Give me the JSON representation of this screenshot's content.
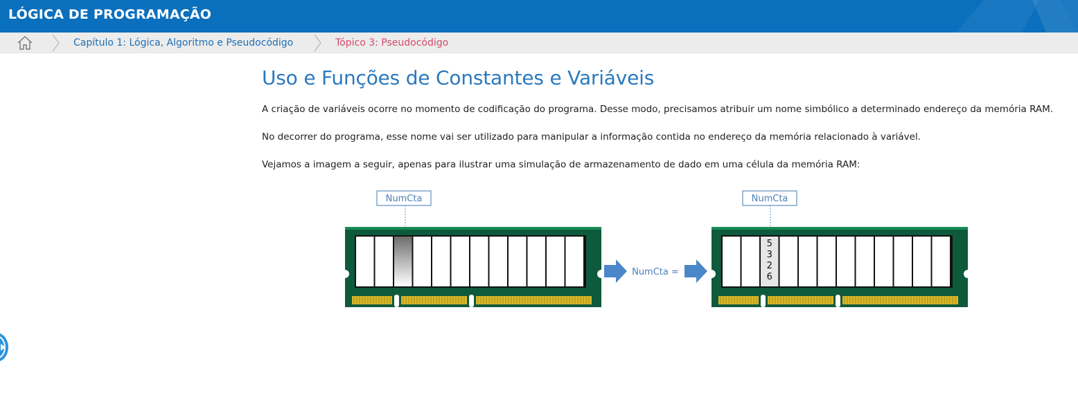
{
  "header": {
    "title": "LÓGICA DE PROGRAMAÇÃO",
    "bar_color": "#0a6fbd"
  },
  "breadcrumb": {
    "home_icon": "home-icon",
    "items": [
      {
        "label": "Capítulo 1: Lógica, Algoritmo e Pseudocódigo",
        "color": "#1e6fb5"
      },
      {
        "label": "Tópico 3: Pseudocódigo",
        "color": "#d34a6e"
      }
    ]
  },
  "main": {
    "title": "Uso e Funções de Constantes e Variáveis",
    "paragraphs": [
      "A criação de variáveis ocorre no momento de codificação do programa. Desse modo, precisamos atribuir um nome simbólico a determinado endereço da memória RAM.",
      "No decorrer do programa, esse nome vai ser utilizado para manipular a informação contida no endereço da memória relacionado à variável.",
      "Vejamos a imagem a seguir, apenas para ilustrar uma simulação de armazenamento de dado em uma célula da memória RAM:"
    ]
  },
  "figure": {
    "left_module": {
      "label": "NumCta"
    },
    "right_module": {
      "label": "NumCta",
      "stored_digits": [
        "5",
        "3",
        "2",
        "6"
      ]
    },
    "assignment_label": "NumCta =",
    "arrow_icon": "arrow-right-icon",
    "board_color": "#0e5a3c",
    "contact_color": "#d8b82a"
  },
  "side_button": {
    "icon": "chevron-right-icon"
  }
}
